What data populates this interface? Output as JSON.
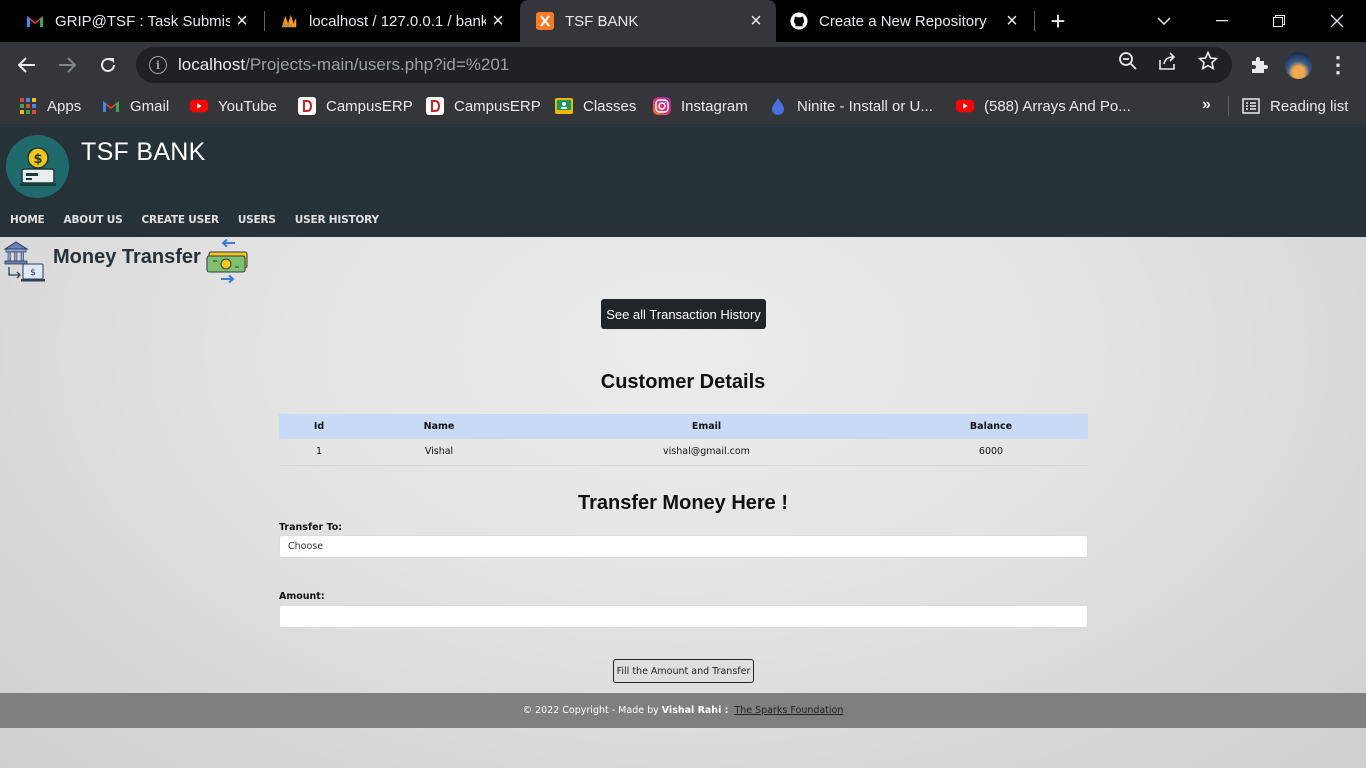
{
  "browser": {
    "tabs": [
      {
        "title": "GRIP@TSF : Task Submissio",
        "icon": "gmail-icon",
        "active": false
      },
      {
        "title": "localhost / 127.0.0.1 / bank",
        "icon": "phpmyadmin-icon",
        "active": false
      },
      {
        "title": "TSF BANK",
        "icon": "xampp-icon",
        "active": true
      },
      {
        "title": "Create a New Repository",
        "icon": "github-icon",
        "active": false
      }
    ],
    "url_host": "localhost",
    "url_path": "/Projects-main/users.php?id=%201",
    "bookmarks": [
      {
        "label": "Apps",
        "icon": "apps-grid-icon"
      },
      {
        "label": "Gmail",
        "icon": "gmail-icon"
      },
      {
        "label": "YouTube",
        "icon": "youtube-icon"
      },
      {
        "label": "CampusERP",
        "icon": "campuserp-icon"
      },
      {
        "label": "CampusERP",
        "icon": "campuserp-icon"
      },
      {
        "label": "Classes",
        "icon": "classroom-icon"
      },
      {
        "label": "Instagram",
        "icon": "instagram-icon"
      },
      {
        "label": "Ninite - Install or U...",
        "icon": "ninite-icon"
      },
      {
        "label": "(588) Arrays And Po...",
        "icon": "youtube-icon"
      }
    ],
    "more_bookmarks": "»",
    "reading_list": "Reading list"
  },
  "site": {
    "brand": "TSF BANK",
    "nav": [
      "HOME",
      "ABOUT US",
      "CREATE USER",
      "USERS",
      "USER HISTORY"
    ]
  },
  "page": {
    "title": "Money Transfer",
    "history_button": "See all Transaction History",
    "customer_heading": "Customer Details",
    "table": {
      "headers": [
        "Id",
        "Name",
        "Email",
        "Balance"
      ],
      "rows": [
        [
          "1",
          "Vishal",
          "vishal@gmail.com",
          "6000"
        ]
      ]
    },
    "transfer_heading": "Transfer Money Here !",
    "transfer_to_label": "Transfer To:",
    "transfer_to_value": "Choose",
    "amount_label": "Amount:",
    "amount_value": "",
    "submit_button": "Fill the Amount and Transfer"
  },
  "footer": {
    "prefix": "© 2022 Copyright - Made by",
    "author": "Vishal Rahi :",
    "link": "The Sparks Foundation"
  },
  "colors": {
    "header_bg": "#263238",
    "table_header_bg": "#c8daf5",
    "footer_bg": "#7f7f7f",
    "dark_button": "#212529"
  }
}
